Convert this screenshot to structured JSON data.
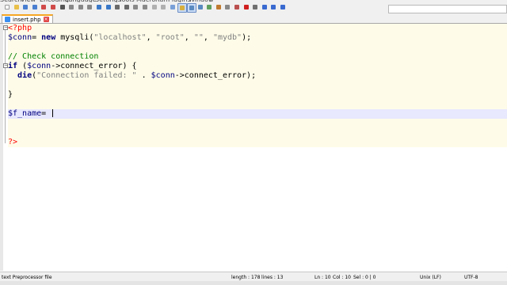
{
  "menu": {
    "items": [
      "Search",
      "View",
      "Encoding",
      "Language",
      "Settings",
      "Tools",
      "Macro",
      "Run",
      "Plugins",
      "Window",
      "?"
    ]
  },
  "toolbar": {
    "icons": [
      "new-file-icon",
      "open-file-icon",
      "save-icon",
      "save-all-icon",
      "close-icon",
      "close-all-icon",
      "print-icon",
      "cut-icon",
      "copy-icon",
      "paste-icon",
      "undo-icon",
      "redo-icon",
      "find-icon",
      "replace-icon",
      "zoom-in-icon",
      "zoom-out-icon",
      "sync-vertical-icon",
      "sync-horizontal-icon",
      "word-wrap-icon",
      "show-all-chars-icon",
      "indent-guide-icon",
      "language-icon",
      "doc-map-icon",
      "function-list-icon",
      "folder-workspace-icon",
      "monitoring-icon",
      "record-macro-icon",
      "stop-recording-icon",
      "playback-icon",
      "run-macro-multiple-icon",
      "save-macro-icon"
    ],
    "search_placeholder": ""
  },
  "tabs": [
    {
      "label": "insert.php",
      "active": true
    }
  ],
  "editor": {
    "lines": [
      {
        "segments": [
          {
            "t": "<?php",
            "c": "php"
          }
        ]
      },
      {
        "segments": [
          {
            "t": "$conn",
            "c": "var"
          },
          {
            "t": "= ",
            "c": ""
          },
          {
            "t": "new",
            "c": "kw"
          },
          {
            "t": " mysqli(",
            "c": ""
          },
          {
            "t": "\"localhost\"",
            "c": "str"
          },
          {
            "t": ", ",
            "c": ""
          },
          {
            "t": "\"root\"",
            "c": "str"
          },
          {
            "t": ", ",
            "c": ""
          },
          {
            "t": "\"\"",
            "c": "str"
          },
          {
            "t": ", ",
            "c": ""
          },
          {
            "t": "\"mydb\"",
            "c": "str"
          },
          {
            "t": ");",
            "c": ""
          }
        ]
      },
      {
        "segments": []
      },
      {
        "segments": [
          {
            "t": "// Check connection",
            "c": "cmt"
          }
        ]
      },
      {
        "segments": [
          {
            "t": "if",
            "c": "kw"
          },
          {
            "t": " (",
            "c": ""
          },
          {
            "t": "$conn",
            "c": "var"
          },
          {
            "t": "->connect_error) {",
            "c": ""
          }
        ]
      },
      {
        "segments": [
          {
            "t": "  ",
            "c": ""
          },
          {
            "t": "die",
            "c": "kw"
          },
          {
            "t": "(",
            "c": ""
          },
          {
            "t": "\"Connection failed: \"",
            "c": "str"
          },
          {
            "t": " . ",
            "c": ""
          },
          {
            "t": "$conn",
            "c": "var"
          },
          {
            "t": "->connect_error);",
            "c": ""
          }
        ]
      },
      {
        "segments": []
      },
      {
        "segments": [
          {
            "t": "}",
            "c": ""
          }
        ]
      },
      {
        "segments": []
      },
      {
        "segments": [
          {
            "t": "$f_name",
            "c": "var"
          },
          {
            "t": "= ",
            "c": ""
          }
        ],
        "current": true
      },
      {
        "segments": []
      },
      {
        "segments": []
      },
      {
        "segments": [
          {
            "t": "?>",
            "c": "php"
          }
        ]
      }
    ]
  },
  "status": {
    "file_type": "text Preprocessor file",
    "length": "length : 178",
    "lines": "lines : 13",
    "ln": "Ln : 10",
    "col": "Col : 10",
    "sel": "Sel : 0 | 0",
    "eol": "Unix (LF)",
    "encoding": "UTF-8"
  }
}
